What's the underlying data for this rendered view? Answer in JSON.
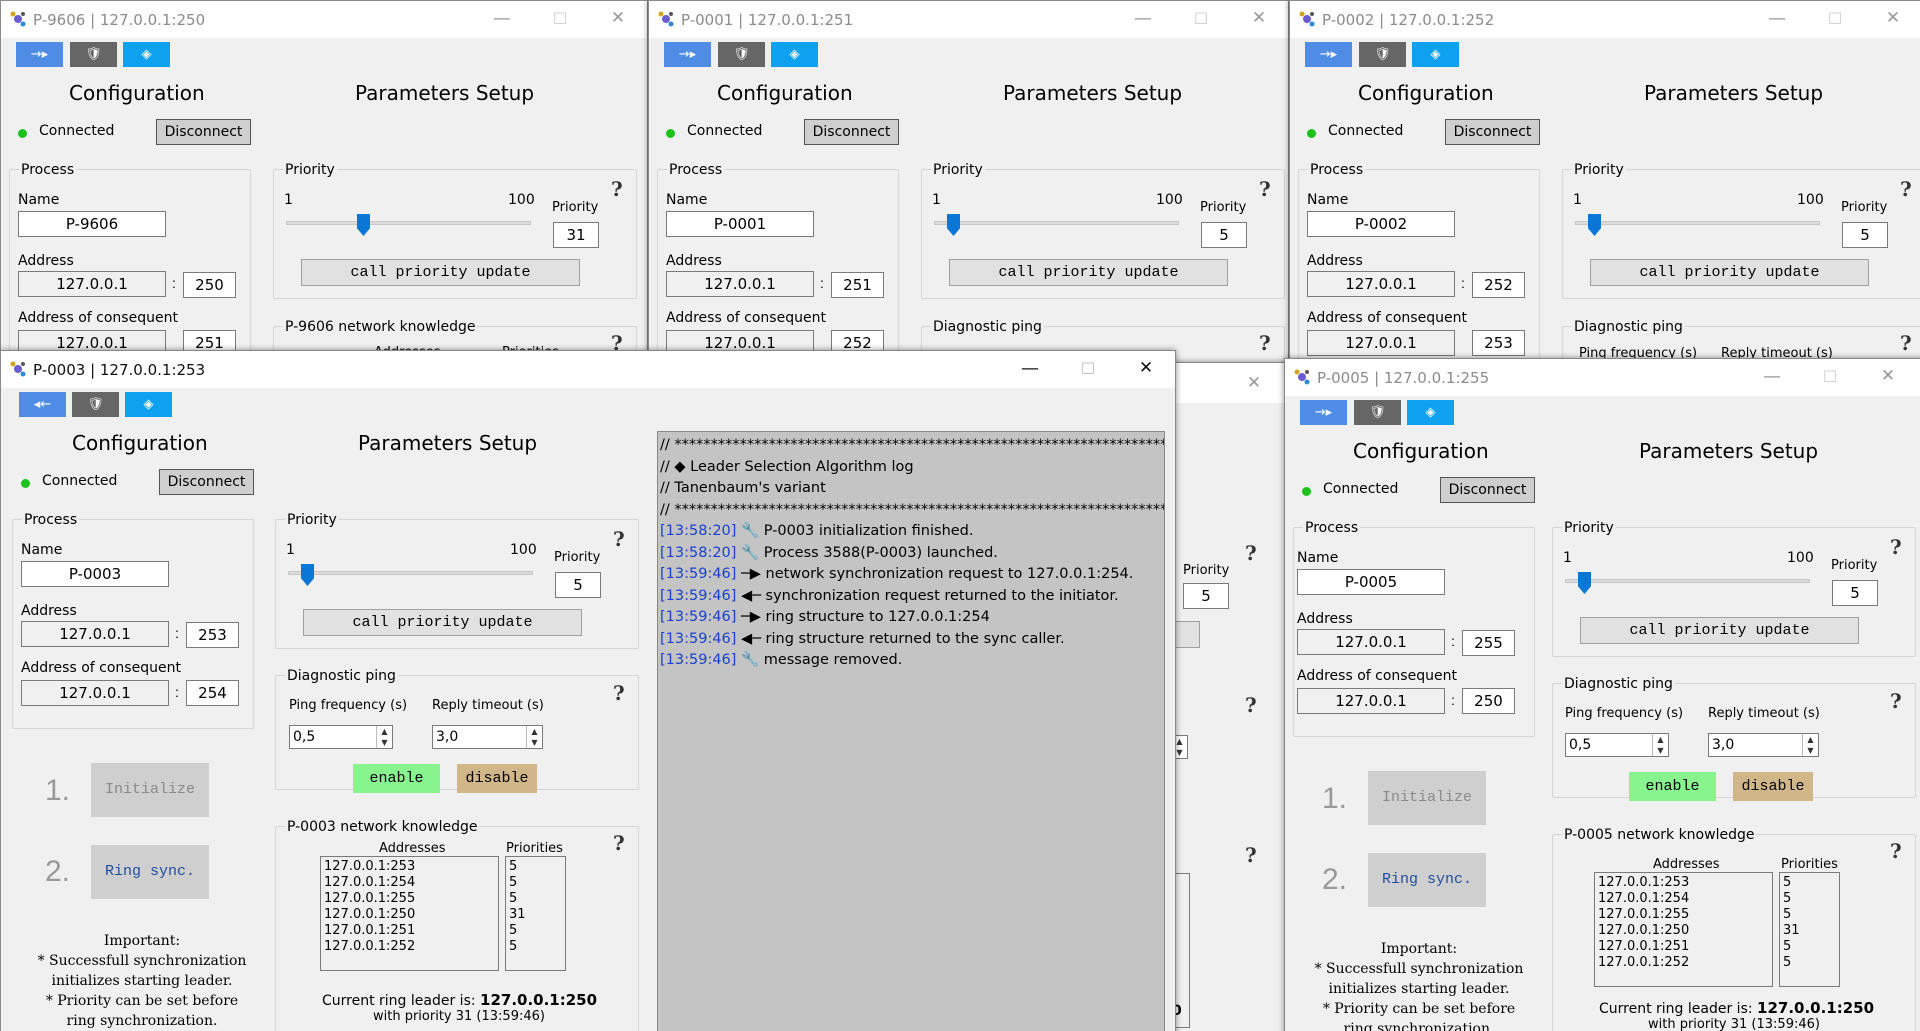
{
  "common": {
    "tools": [
      "→▸",
      "🛡",
      "◈"
    ],
    "tools_back": [
      "◂←",
      "🛡",
      "◈"
    ],
    "configuration": "Configuration",
    "parameters": "Parameters Setup",
    "connected": "Connected",
    "disconnect": "Disconnect",
    "process": "Process",
    "name": "Name",
    "address": "Address",
    "consequent": "Address of consequent",
    "priority_group": "Priority",
    "min": "1",
    "max": "100",
    "priority_label": "Priority",
    "call_update": "call priority update",
    "diag": "Diagnostic ping",
    "ping_freq": "Ping frequency (s)",
    "reply_to": "Reply timeout (s)",
    "enable": "enable",
    "disable": "disable",
    "step1": "1.",
    "step2": "2.",
    "initialize": "Initialize",
    "ring_sync": "Ring sync.",
    "important": "Important:\n* Successfull synchronization\ninitializes starting leader.\n* Priority can be set before\nring synchronization.",
    "addresses": "Addresses",
    "priorities": "Priorities",
    "leader_label": "Current ring leader is:",
    "minimize": "—",
    "maximize": "☐",
    "close": "✕"
  },
  "windows": {
    "w9606": {
      "title": "P-9606 | 127.0.0.1:250",
      "name": "P-9606",
      "ip": "127.0.0.1",
      "port": "250",
      "cons_ip": "127.0.0.1",
      "cons_port": "251",
      "priority": "31",
      "priority_value": 31,
      "knowledge": "P-9606 network knowledge",
      "addr_partial": "Addresses",
      "prio_partial": "Priorities"
    },
    "w0001": {
      "title": "P-0001 | 127.0.0.1:251",
      "name": "P-0001",
      "ip": "127.0.0.1",
      "port": "251",
      "cons_ip": "127.0.0.1",
      "cons_port": "252",
      "priority": "5",
      "priority_value": 5
    },
    "w0002": {
      "title": "P-0002 | 127.0.0.1:252",
      "name": "P-0002",
      "ip": "127.0.0.1",
      "port": "252",
      "cons_ip": "127.0.0.1",
      "cons_port": "253",
      "priority": "5",
      "priority_value": 5,
      "ping_partial": "Ping frequency (s)",
      "reply_partial": "Reply timeout (s)"
    },
    "w0004": {
      "priority": "5",
      "leader_partial": "0"
    },
    "w0003": {
      "title": "P-0003 | 127.0.0.1:253",
      "name": "P-0003",
      "ip": "127.0.0.1",
      "port": "253",
      "cons_ip": "127.0.0.1",
      "cons_port": "254",
      "priority": "5",
      "priority_value": 5,
      "ping": "0,5",
      "timeout": "3,0",
      "knowledge": "P-0003 network knowledge",
      "addr_list": [
        "127.0.0.1:253",
        "127.0.0.1:254",
        "127.0.0.1:255",
        "127.0.0.1:250",
        "127.0.0.1:251",
        "127.0.0.1:252"
      ],
      "prio_list": [
        "5",
        "5",
        "5",
        "31",
        "5",
        "5"
      ],
      "leader": "127.0.0.1:250",
      "leader_sub": "with priority 31 (13:59:46)"
    },
    "w0005": {
      "title": "P-0005 | 127.0.0.1:255",
      "name": "P-0005",
      "ip": "127.0.0.1",
      "port": "255",
      "cons_ip": "127.0.0.1",
      "cons_port": "250",
      "priority": "5",
      "priority_value": 5,
      "ping": "0,5",
      "timeout": "3,0",
      "knowledge": "P-0005 network knowledge",
      "addr_list": [
        "127.0.0.1:253",
        "127.0.0.1:254",
        "127.0.0.1:255",
        "127.0.0.1:250",
        "127.0.0.1:251",
        "127.0.0.1:252"
      ],
      "prio_list": [
        "5",
        "5",
        "5",
        "31",
        "5",
        "5"
      ],
      "leader": "127.0.0.1:250",
      "leader_sub": "with priority 31 (13:59:46)"
    }
  },
  "log": [
    {
      "ts": "",
      "text": "// ********************************************************************"
    },
    {
      "ts": "",
      "text": "// ◆ Leader Selection Algorithm log"
    },
    {
      "ts": "",
      "text": "// Tanenbaum's variant"
    },
    {
      "ts": "",
      "text": "// ********************************************************************"
    },
    {
      "ts": "[13:58:20]",
      "text": " 🔧 P-0003 initialization finished."
    },
    {
      "ts": "[13:58:20]",
      "text": " 🔧 Process 3588(P-0003) launched."
    },
    {
      "ts": "[13:59:46]",
      "text": " ─▶ network synchronization request to 127.0.0.1:254."
    },
    {
      "ts": "[13:59:46]",
      "text": " ◀─ synchronization request returned to the initiator."
    },
    {
      "ts": "[13:59:46]",
      "text": " ─▶ ring structure to 127.0.0.1:254"
    },
    {
      "ts": "[13:59:46]",
      "text": " ◀─ ring structure returned to the sync caller."
    },
    {
      "ts": "[13:59:46]",
      "text": " 🔧 message removed."
    }
  ],
  "colors": {
    "accent_blue": "#4e8ce6",
    "enable_green": "#88f48e",
    "disable_tan": "#d1b68a",
    "connected_green": "#1bc21b",
    "timestamp_blue": "#1a3fd1"
  },
  "icons": [
    "app-icon",
    "arrow-right-icon",
    "arrow-left-icon",
    "shield-icon",
    "diamond-icon",
    "help-icon",
    "wrench-icon"
  ]
}
